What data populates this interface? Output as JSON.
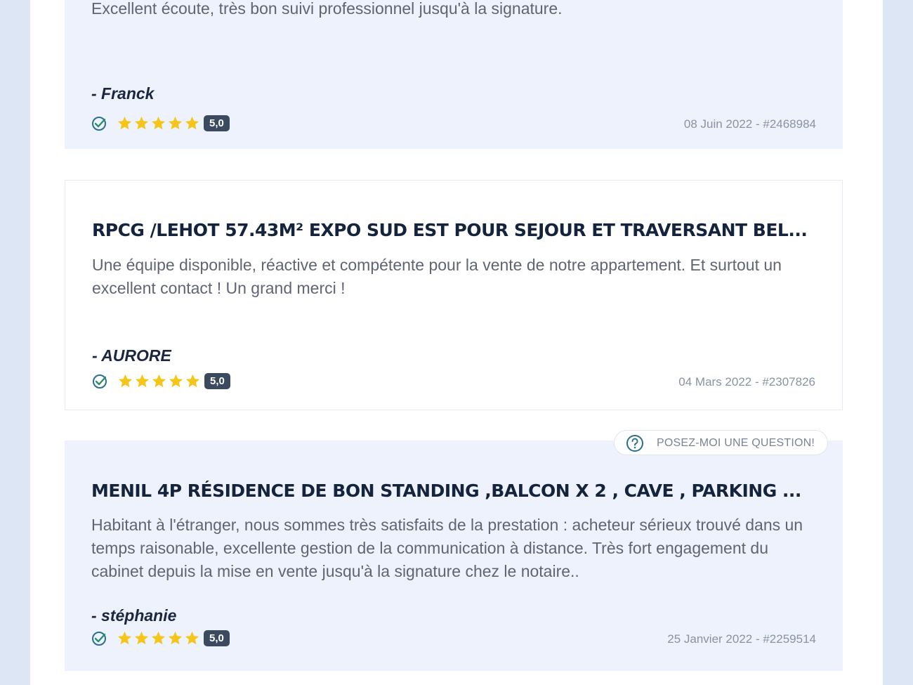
{
  "reviews": [
    {
      "title": "",
      "text": "Excellent écoute, très bon suivi professionnel jusqu'à la signature.",
      "author": "- Franck",
      "score": "5,0",
      "date": "08 Juin 2022 - #2468984",
      "rating": 5
    },
    {
      "title": "RPCG /LEHOT 57.43M² EXPO SUD EST POUR SEJOUR ET TRAVERSANT BEL...",
      "text": "Une équipe disponible, réactive et compétente pour la vente de notre appartement. Et surtout un excellent contact ! Un grand merci !",
      "author": "- AURORE",
      "score": "5,0",
      "date": "04 Mars 2022 - #2307826",
      "rating": 5
    },
    {
      "title": "MENIL 4P RÉSIDENCE DE BON STANDING ,BALCON X 2 , CAVE , PARKING ...",
      "text": "Habitant à l'étranger, nous sommes très satisfaits de la prestation : acheteur sérieux trouvé dans un temps raisonable, excellente gestion de la communication à distance. Très fort engagement du cabinet depuis la mise en vente jusqu'à la signature chez le notaire..",
      "author": "- stéphanie",
      "score": "5,0",
      "date": "25 Janvier 2022 - #2259514",
      "rating": 5
    }
  ],
  "question_button": {
    "label": "POSEZ-MOI UNE QUESTION!",
    "icon": "question-circle-icon"
  },
  "colors": {
    "star": "#f5c518",
    "verified": "#2a6f8f",
    "badge": "#3b4a5f"
  }
}
